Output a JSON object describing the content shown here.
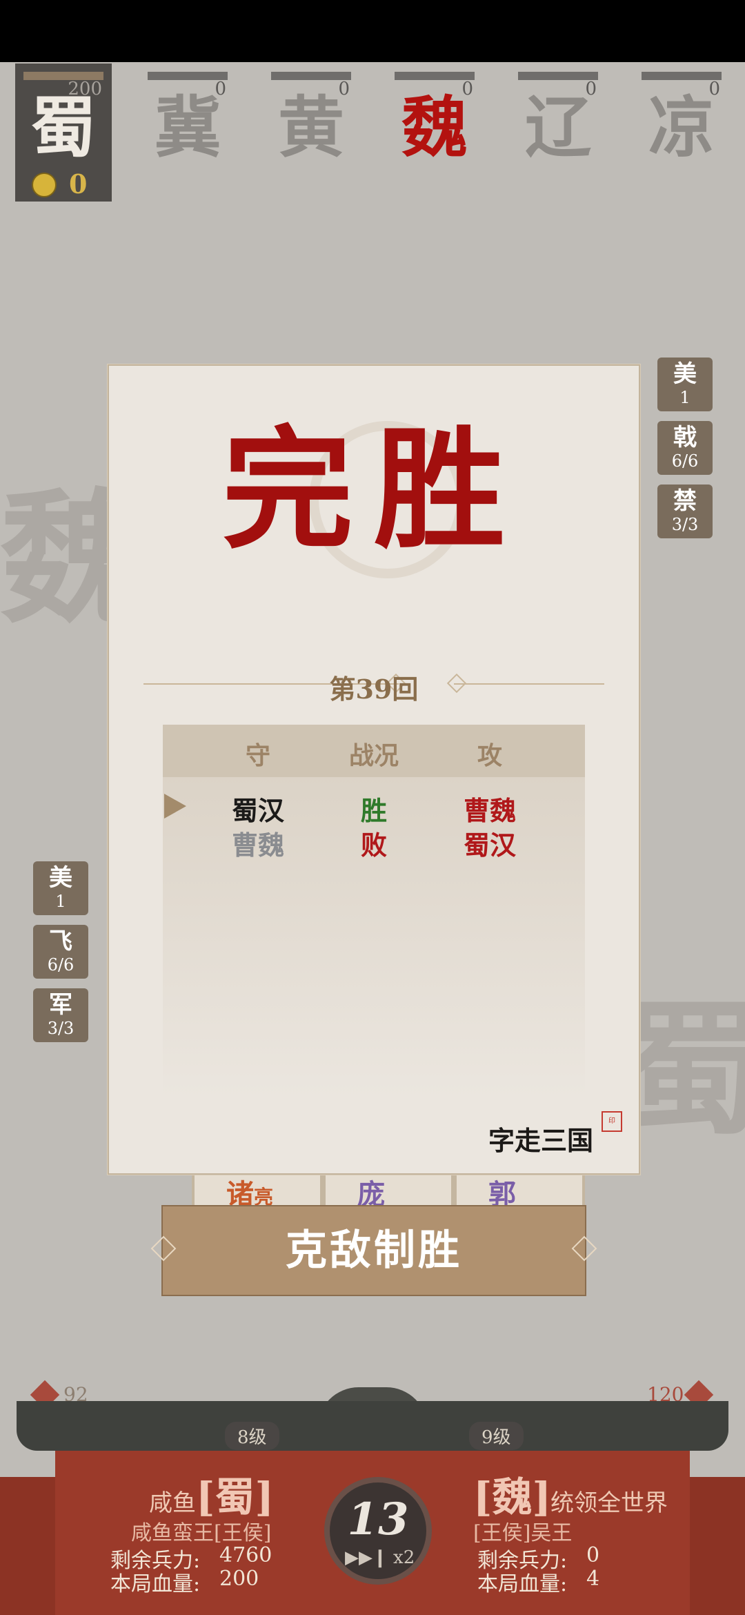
{
  "factions": [
    {
      "name": "蜀",
      "count": "200",
      "state": "player"
    },
    {
      "name": "冀",
      "count": "0",
      "state": "inactive"
    },
    {
      "name": "黄",
      "count": "0",
      "state": "inactive"
    },
    {
      "name": "魏",
      "count": "0",
      "state": "enemy"
    },
    {
      "name": "辽",
      "count": "0",
      "state": "inactive"
    },
    {
      "name": "凉",
      "count": "0",
      "state": "inactive"
    }
  ],
  "coins": "0",
  "right_tags": [
    {
      "label": "美",
      "value": "1"
    },
    {
      "label": "戟",
      "value": "6/6"
    },
    {
      "label": "禁",
      "value": "3/3"
    }
  ],
  "left_tags": [
    {
      "label": "美",
      "value": "1"
    },
    {
      "label": "飞",
      "value": "6/6"
    },
    {
      "label": "军",
      "value": "3/3"
    }
  ],
  "watermark_left": "魏",
  "watermark_right": "蜀",
  "modal": {
    "title": "完胜",
    "round": "第39回",
    "headers": {
      "defend": "守",
      "status": "战况",
      "attack": "攻"
    },
    "rows": [
      {
        "defend": "蜀汉",
        "status": "胜",
        "attack": "曹魏"
      },
      {
        "defend": "曹魏",
        "status": "败",
        "attack": "蜀汉"
      }
    ],
    "logo": "字走三国",
    "stamp": "印"
  },
  "cards": [
    {
      "top": "诸",
      "side": "亮",
      "color": "#c85a2a"
    },
    {
      "top": "庞",
      "side": "",
      "color": "#7a5ea8"
    },
    {
      "top": "郭",
      "side": "",
      "color": "#7a5ea8"
    }
  ],
  "confirm_button": "克敌制胜",
  "bottom": {
    "left_troop_count": "92",
    "right_troop_count": "120",
    "left_level": "8级",
    "right_level": "9级",
    "left_player": {
      "nickname": "咸鱼",
      "faction": "[蜀]",
      "title": "咸鱼蛮王[王侯]",
      "troops_label": "剩余兵力:",
      "troops": "4760",
      "hp_label": "本局血量:",
      "hp": "200"
    },
    "right_player": {
      "nickname": "统领全世界",
      "faction": "[魏]",
      "title": "[王侯]吴王",
      "troops_label": "剩余兵力:",
      "troops": "0",
      "hp_label": "本局血量:",
      "hp": "4"
    },
    "turn": "13",
    "speed": "x2"
  }
}
